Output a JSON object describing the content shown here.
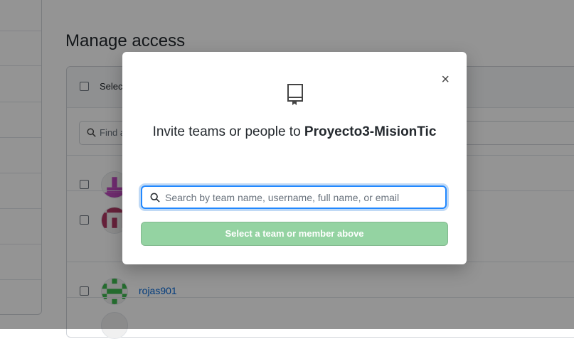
{
  "page": {
    "title": "Manage access",
    "select_all_label": "Select all",
    "find_placeholder": "Find a collaborator…",
    "collaborators": [
      {
        "name": "",
        "avatar_color": "#c04bbf"
      },
      {
        "name": "",
        "avatar_color": "#b03a65"
      },
      {
        "name": "rojas901",
        "avatar_color": "#3fb950"
      }
    ]
  },
  "modal": {
    "close_label": "×",
    "icon": "repo-icon",
    "invite_prefix": "Invite teams or people to ",
    "repo_name": "Proyecto3-MisionTic",
    "search_placeholder": "Search by team name, username, full name, or email",
    "submit_label": "Select a team or member above"
  },
  "colors": {
    "accent_focus": "#2188ff",
    "button_disabled_green": "#94d3a2",
    "link": "#0366d6"
  }
}
